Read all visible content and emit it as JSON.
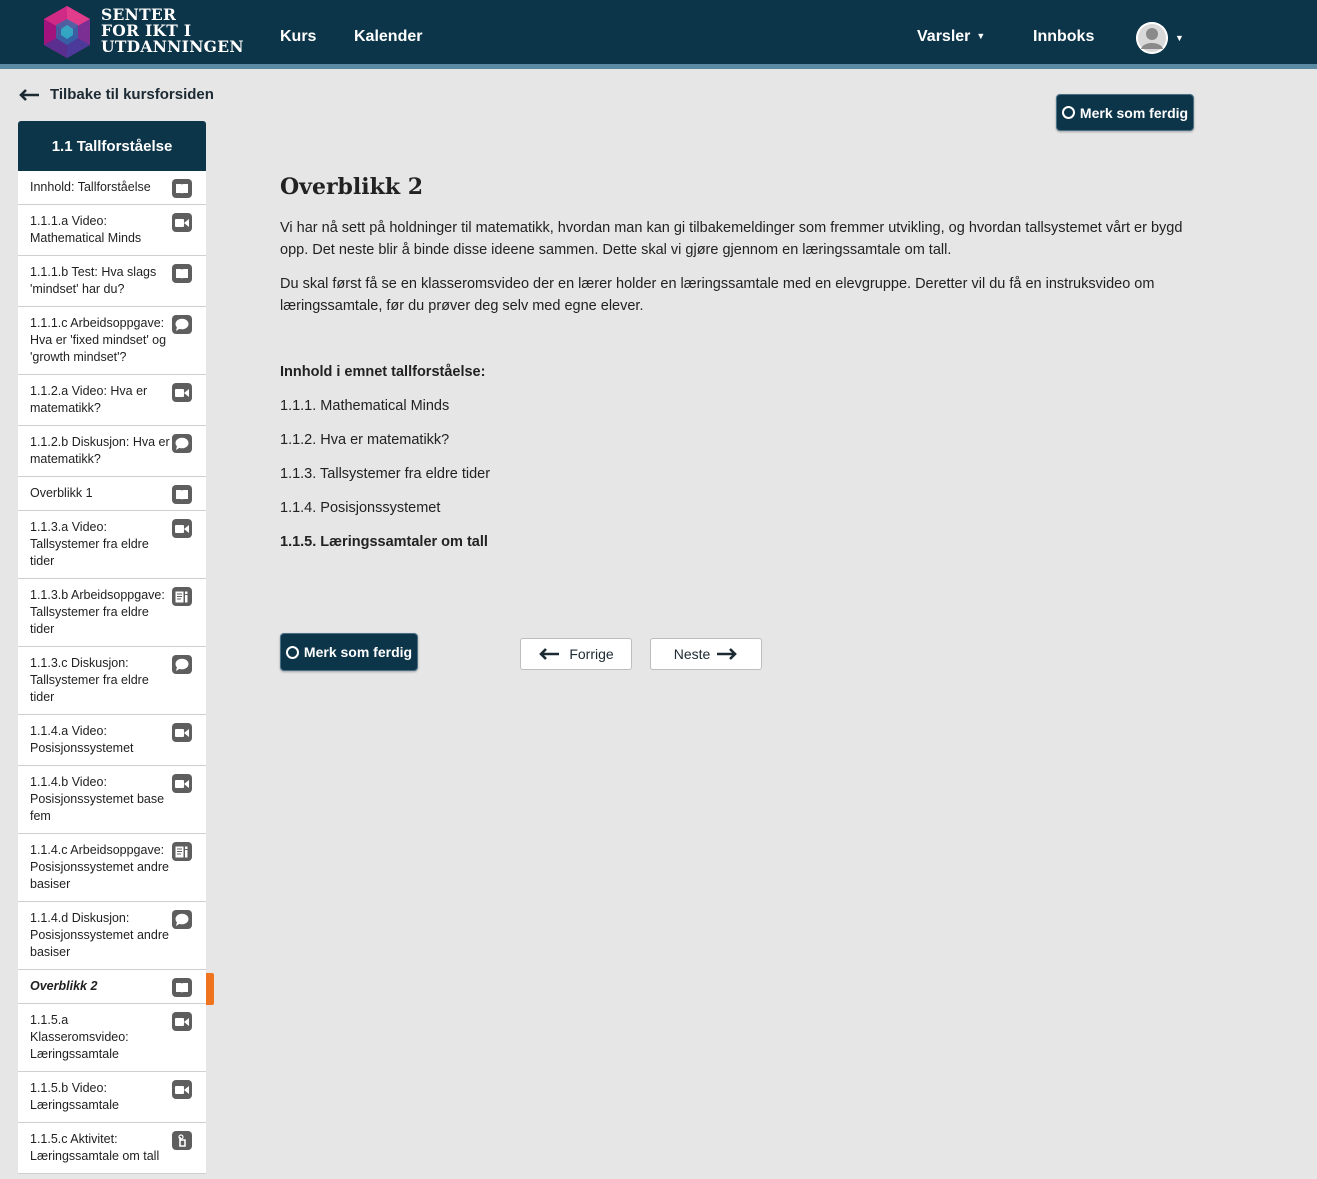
{
  "header": {
    "logo_lines": [
      "SENTER",
      "FOR IKT I",
      "UTDANNINGEN"
    ],
    "nav": [
      "Kurs",
      "Kalender"
    ],
    "notifications_label": "Varsler",
    "inbox_label": "Innboks"
  },
  "back_link": "Tilbake til kursforsiden",
  "sidebar": {
    "title": "1.1 Tallforståelse",
    "items": [
      {
        "label": "Innhold: Tallforståelse",
        "icon": "book-icon"
      },
      {
        "label": "1.1.1.a Video: Mathematical Minds",
        "icon": "video-icon"
      },
      {
        "label": "1.1.1.b Test: Hva slags 'mindset' har du?",
        "icon": "book-icon"
      },
      {
        "label": "1.1.1.c Arbeidsoppgave: Hva er 'fixed mindset' og 'growth mindset'?",
        "icon": "discussion-icon"
      },
      {
        "label": "1.1.2.a Video: Hva er matematikk?",
        "icon": "video-icon"
      },
      {
        "label": "1.1.2.b Diskusjon: Hva er matematikk?",
        "icon": "discussion-icon"
      },
      {
        "label": "Overblikk 1",
        "icon": "book-icon"
      },
      {
        "label": "1.1.3.a Video: Tallsystemer fra eldre tider",
        "icon": "video-icon"
      },
      {
        "label": "1.1.3.b Arbeidsoppgave: Tallsystemer fra eldre tider",
        "icon": "assignment-icon"
      },
      {
        "label": "1.1.3.c Diskusjon: Tallsystemer fra eldre tider",
        "icon": "discussion-icon"
      },
      {
        "label": "1.1.4.a Video: Posisjonssystemet",
        "icon": "video-icon"
      },
      {
        "label": "1.1.4.b Video: Posisjonssystemet base fem",
        "icon": "video-icon"
      },
      {
        "label": "1.1.4.c Arbeidsoppgave: Posisjonssystemet andre basiser",
        "icon": "assignment-icon"
      },
      {
        "label": "1.1.4.d Diskusjon: Posisjonssystemet andre basiser",
        "icon": "discussion-icon"
      },
      {
        "label": "Overblikk 2",
        "icon": "book-icon",
        "active": true
      },
      {
        "label": "1.1.5.a Klasseromsvideo: Læringssamtale",
        "icon": "video-icon"
      },
      {
        "label": "1.1.5.b Video: Læringssamtale",
        "icon": "video-icon"
      },
      {
        "label": "1.1.5.c Aktivitet: Læringssamtale om tall",
        "icon": "activity-icon"
      }
    ]
  },
  "main": {
    "mark_done_label": "Merk som ferdig",
    "title": "Overblikk 2",
    "paragraphs": [
      "Vi har nå sett på holdninger til matematikk, hvordan man kan gi tilbakemeldinger som fremmer utvikling, og hvordan tallsystemet vårt er bygd opp. Det neste blir å binde disse ideene sammen. Dette skal vi gjøre gjennom en læringssamtale om tall.",
      "Du skal først få se en klasseromsvideo der en lærer holder en læringssamtale med en elevgruppe. Deretter vil du få en instruksvideo om læringssamtale, før du prøver deg selv med egne elever."
    ],
    "content_heading": "Innhold i emnet tallforståelse:",
    "topics": [
      "1.1.1. Mathematical Minds",
      "1.1.2. Hva er matematikk?",
      "1.1.3. Tallsystemer fra eldre tider",
      "1.1.4. Posisjonssystemet",
      "1.1.5. Læringssamtaler om tall"
    ],
    "prev_label": "Forrige",
    "next_label": "Neste"
  },
  "colors": {
    "header_bg": "#0d3549",
    "accent_orange": "#f0731d",
    "page_bg": "#e6e6e6"
  }
}
